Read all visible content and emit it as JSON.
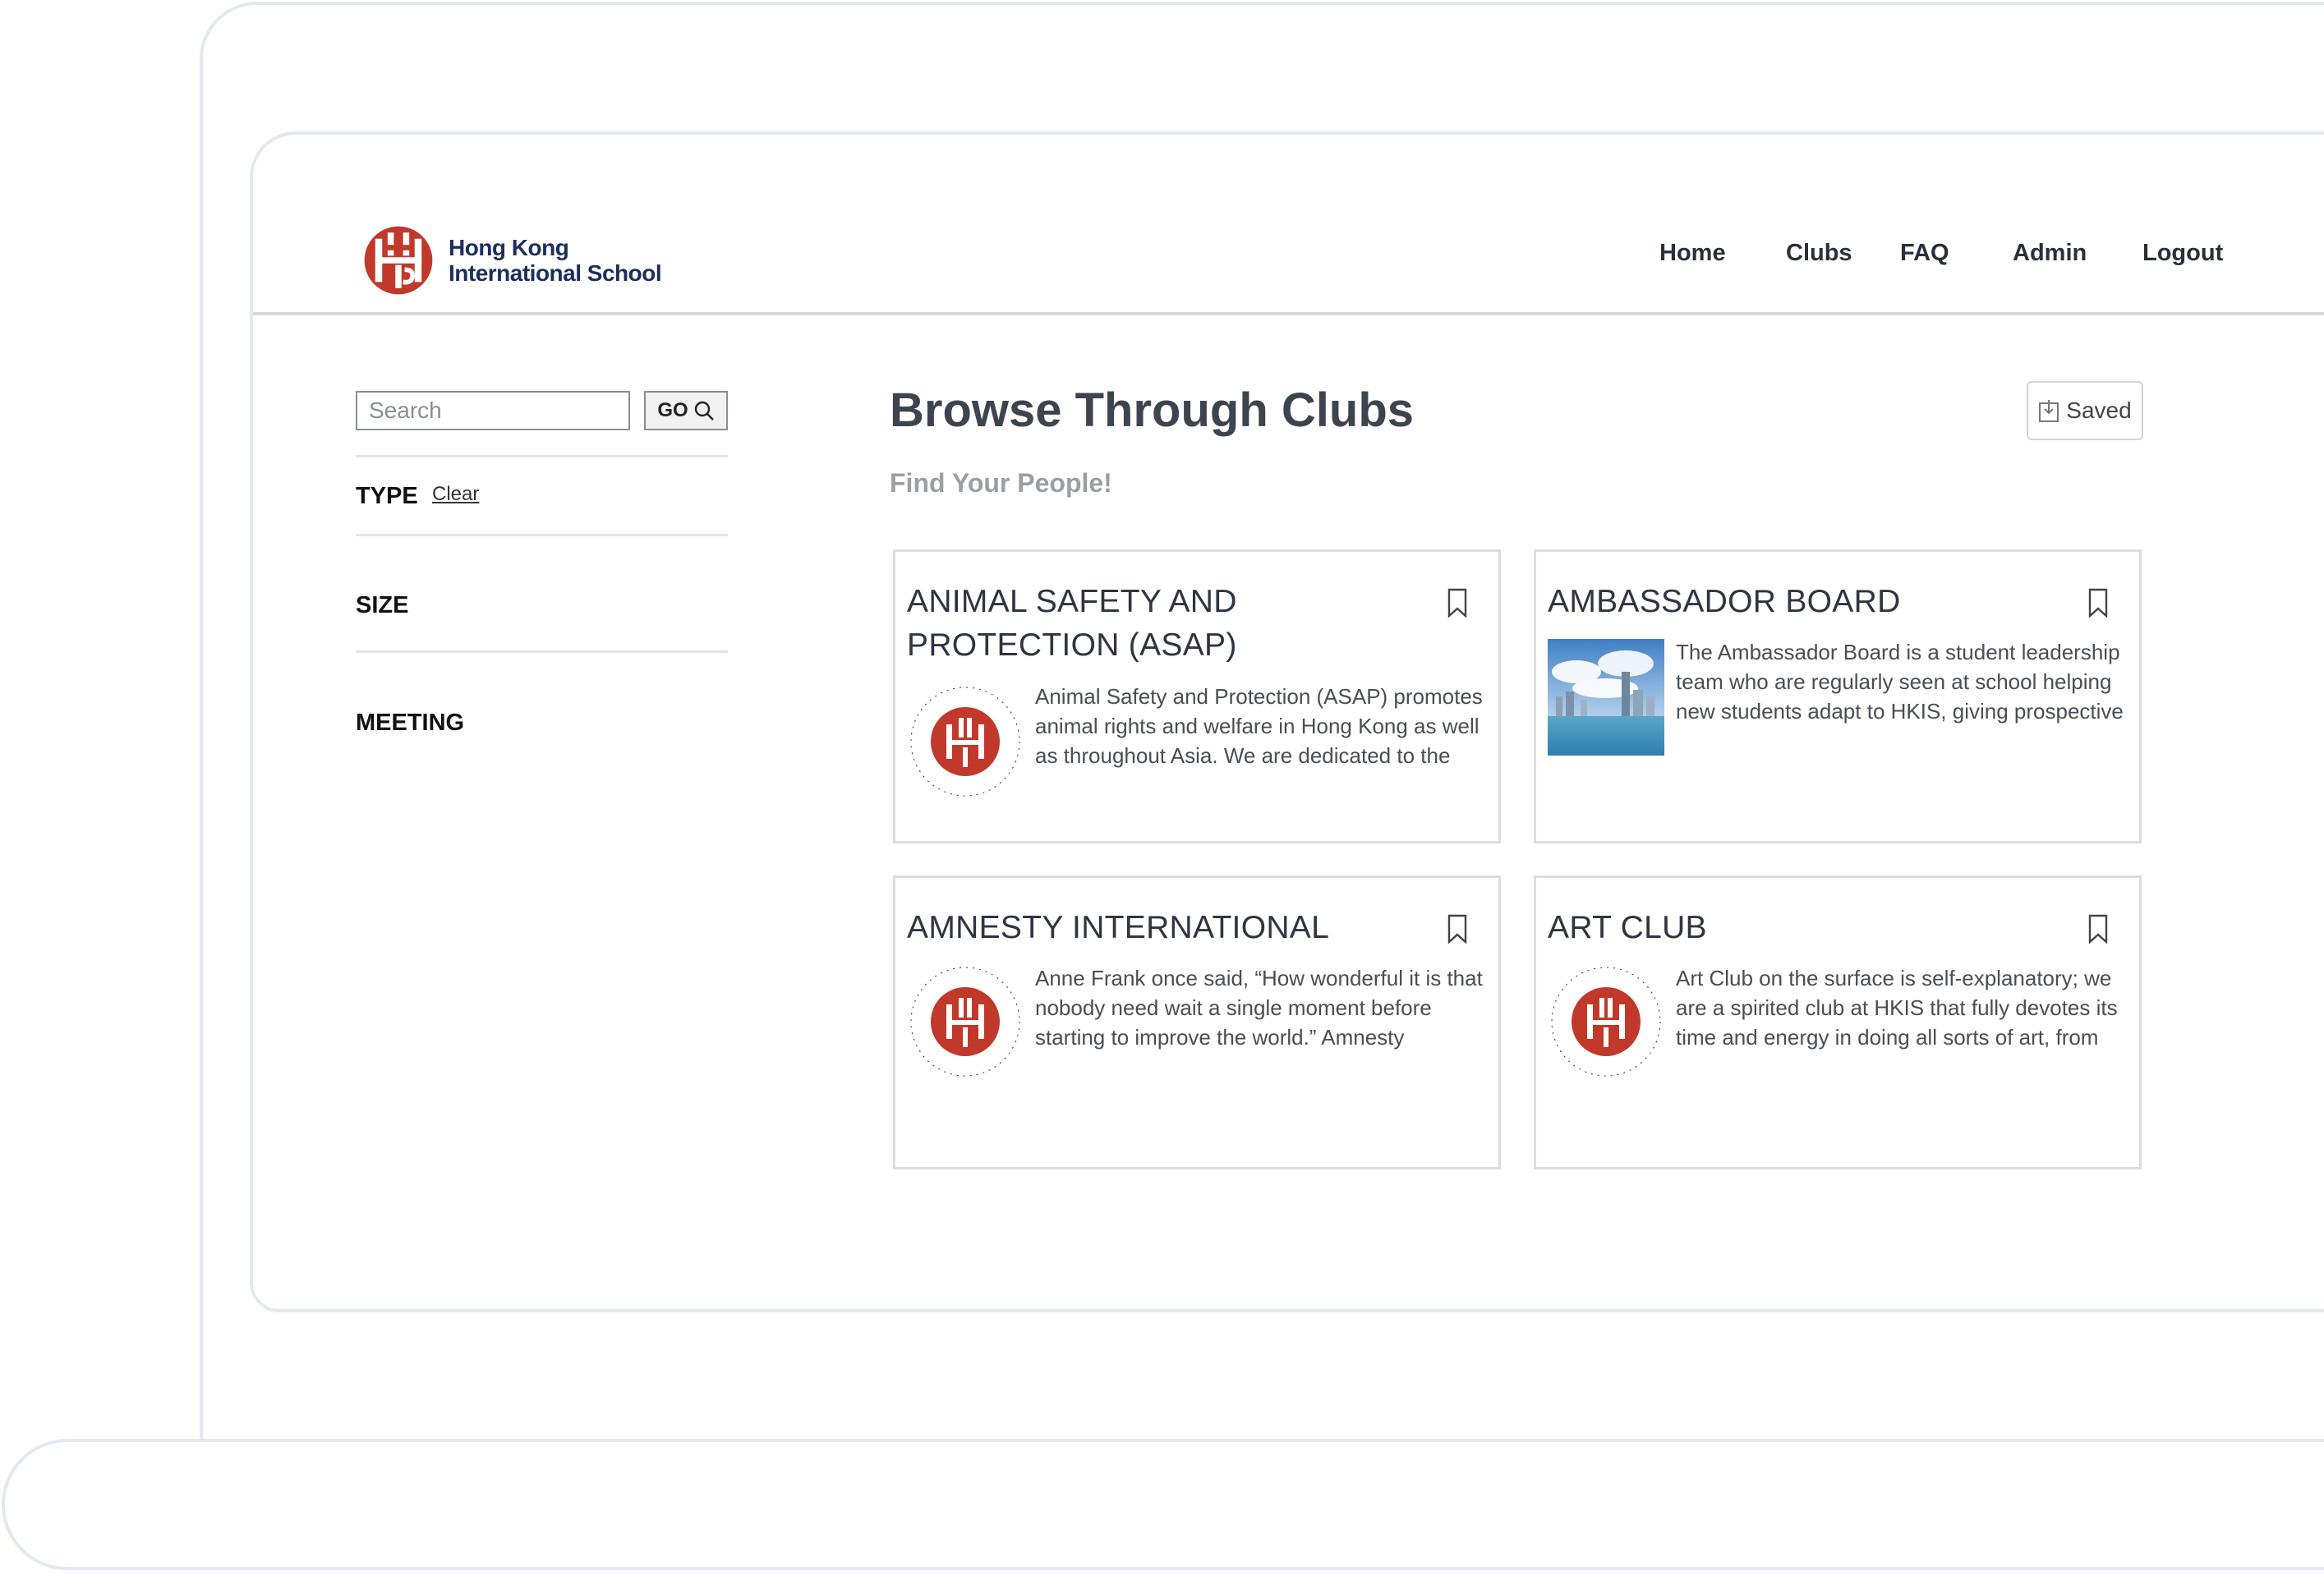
{
  "header": {
    "logo_line1": "Hong Kong",
    "logo_line2": "International School",
    "nav": [
      "Home",
      "Clubs",
      "FAQ",
      "Admin",
      "Logout"
    ]
  },
  "sidebar": {
    "search_placeholder": "Search",
    "go_label": "GO",
    "filters": {
      "type": "TYPE",
      "clear": "Clear",
      "size": "SIZE",
      "meeting": "MEETING"
    }
  },
  "main": {
    "title": "Browse Through Clubs",
    "subtitle": "Find Your People!",
    "saved_label": "Saved",
    "clubs": [
      {
        "title": "ANIMAL SAFETY AND PROTECTION (ASAP)",
        "thumb": "hkis-seal",
        "description": "Animal Safety and Protection (ASAP) promotes animal rights and welfare in Hong Kong as well as throughout Asia. We are dedicated to the support of local animal"
      },
      {
        "title": "AMBASSADOR BOARD",
        "thumb": "hong-kong-skyline-photo",
        "description": "The Ambassador Board is a student leadership team who are regularly seen at school helping new students adapt to HKIS, giving prospective families tours, offering"
      },
      {
        "title": "AMNESTY INTERNATIONAL",
        "thumb": "hkis-seal",
        "description": "Anne Frank once said, “How wonderful it is that nobody need wait a single moment before starting to improve the world.” Amnesty International’s mission and goal is to"
      },
      {
        "title": "ART CLUB",
        "thumb": "hkis-seal",
        "description": "Art Club on the surface is self-explanatory; we are a spirited club at HKIS that fully devotes its time and energy in doing all sorts of art, from sculpture to screen-printing. Beyond"
      }
    ]
  },
  "colors": {
    "brand_red": "#c0392b",
    "brand_navy": "#1c2e5c",
    "frame": "#e4e9f1"
  }
}
